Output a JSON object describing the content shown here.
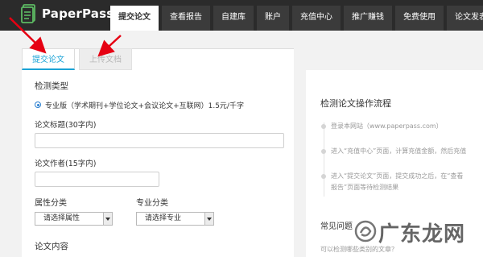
{
  "header": {
    "logo_text": "PaperPass",
    "nav": [
      {
        "label": "提交论文",
        "active": true
      },
      {
        "label": "查看报告"
      },
      {
        "label": "自建库"
      },
      {
        "label": "账户"
      },
      {
        "label": "充值中心"
      },
      {
        "label": "推广赚钱"
      },
      {
        "label": "免费使用"
      },
      {
        "label": "论文发表"
      }
    ]
  },
  "tabs": {
    "submit": "提交论文",
    "upload": "上传文档"
  },
  "form": {
    "detect_type_label": "检测类型",
    "option_label": "专业版（学术期刊+学位论文+会议论文+互联网）1.5元/千字",
    "title_label": "论文标题(30字内)",
    "title_value": "",
    "author_label": "论文作者(15字内)",
    "author_value": "",
    "attr_label": "属性分类",
    "attr_select": "请选择属性",
    "major_label": "专业分类",
    "major_select": "请选择专业",
    "content_label": "论文内容"
  },
  "flow": {
    "title": "检测论文操作流程",
    "steps": [
      "登录本网站（www.paperpass.com）",
      "进入“充值中心”页面，计算充值金额，然后充值",
      "进入“提交论文”页面，提交成功之后，在“查看",
      "报告”页面等待检测结果"
    ]
  },
  "faq": {
    "title": "常见问题",
    "question": "可以检测哪些类别的文章？"
  },
  "watermark": {
    "text": "广东龙网"
  },
  "colors": {
    "header_bg": "#2b2b2b",
    "accent": "#1aa3d6",
    "arrow": "#e60012"
  }
}
